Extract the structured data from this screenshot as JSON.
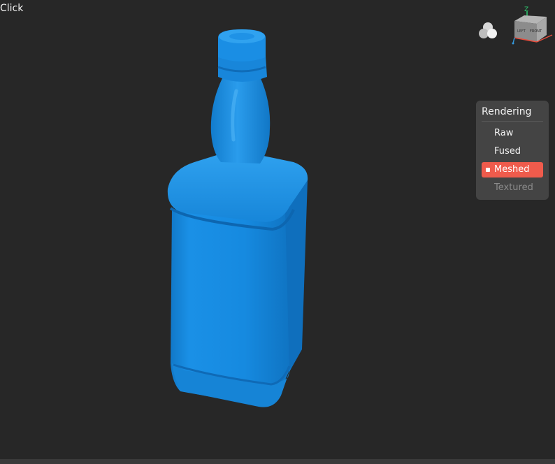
{
  "viewport": {
    "hint_text": "Click",
    "background": "#272727",
    "model_color": "#1a8fe3"
  },
  "view_cube": {
    "axis_z": "Z",
    "face_front": "FRONT",
    "face_left": "LEFT"
  },
  "rendering_panel": {
    "title": "Rendering",
    "options": [
      {
        "label": "Raw",
        "state": "normal"
      },
      {
        "label": "Fused",
        "state": "normal"
      },
      {
        "label": "Meshed",
        "state": "selected"
      },
      {
        "label": "Textured",
        "state": "disabled"
      }
    ],
    "accent": "#ef5b4c"
  },
  "icons": {
    "light": "lighting-spheres-icon",
    "cube": "view-cube-icon"
  }
}
